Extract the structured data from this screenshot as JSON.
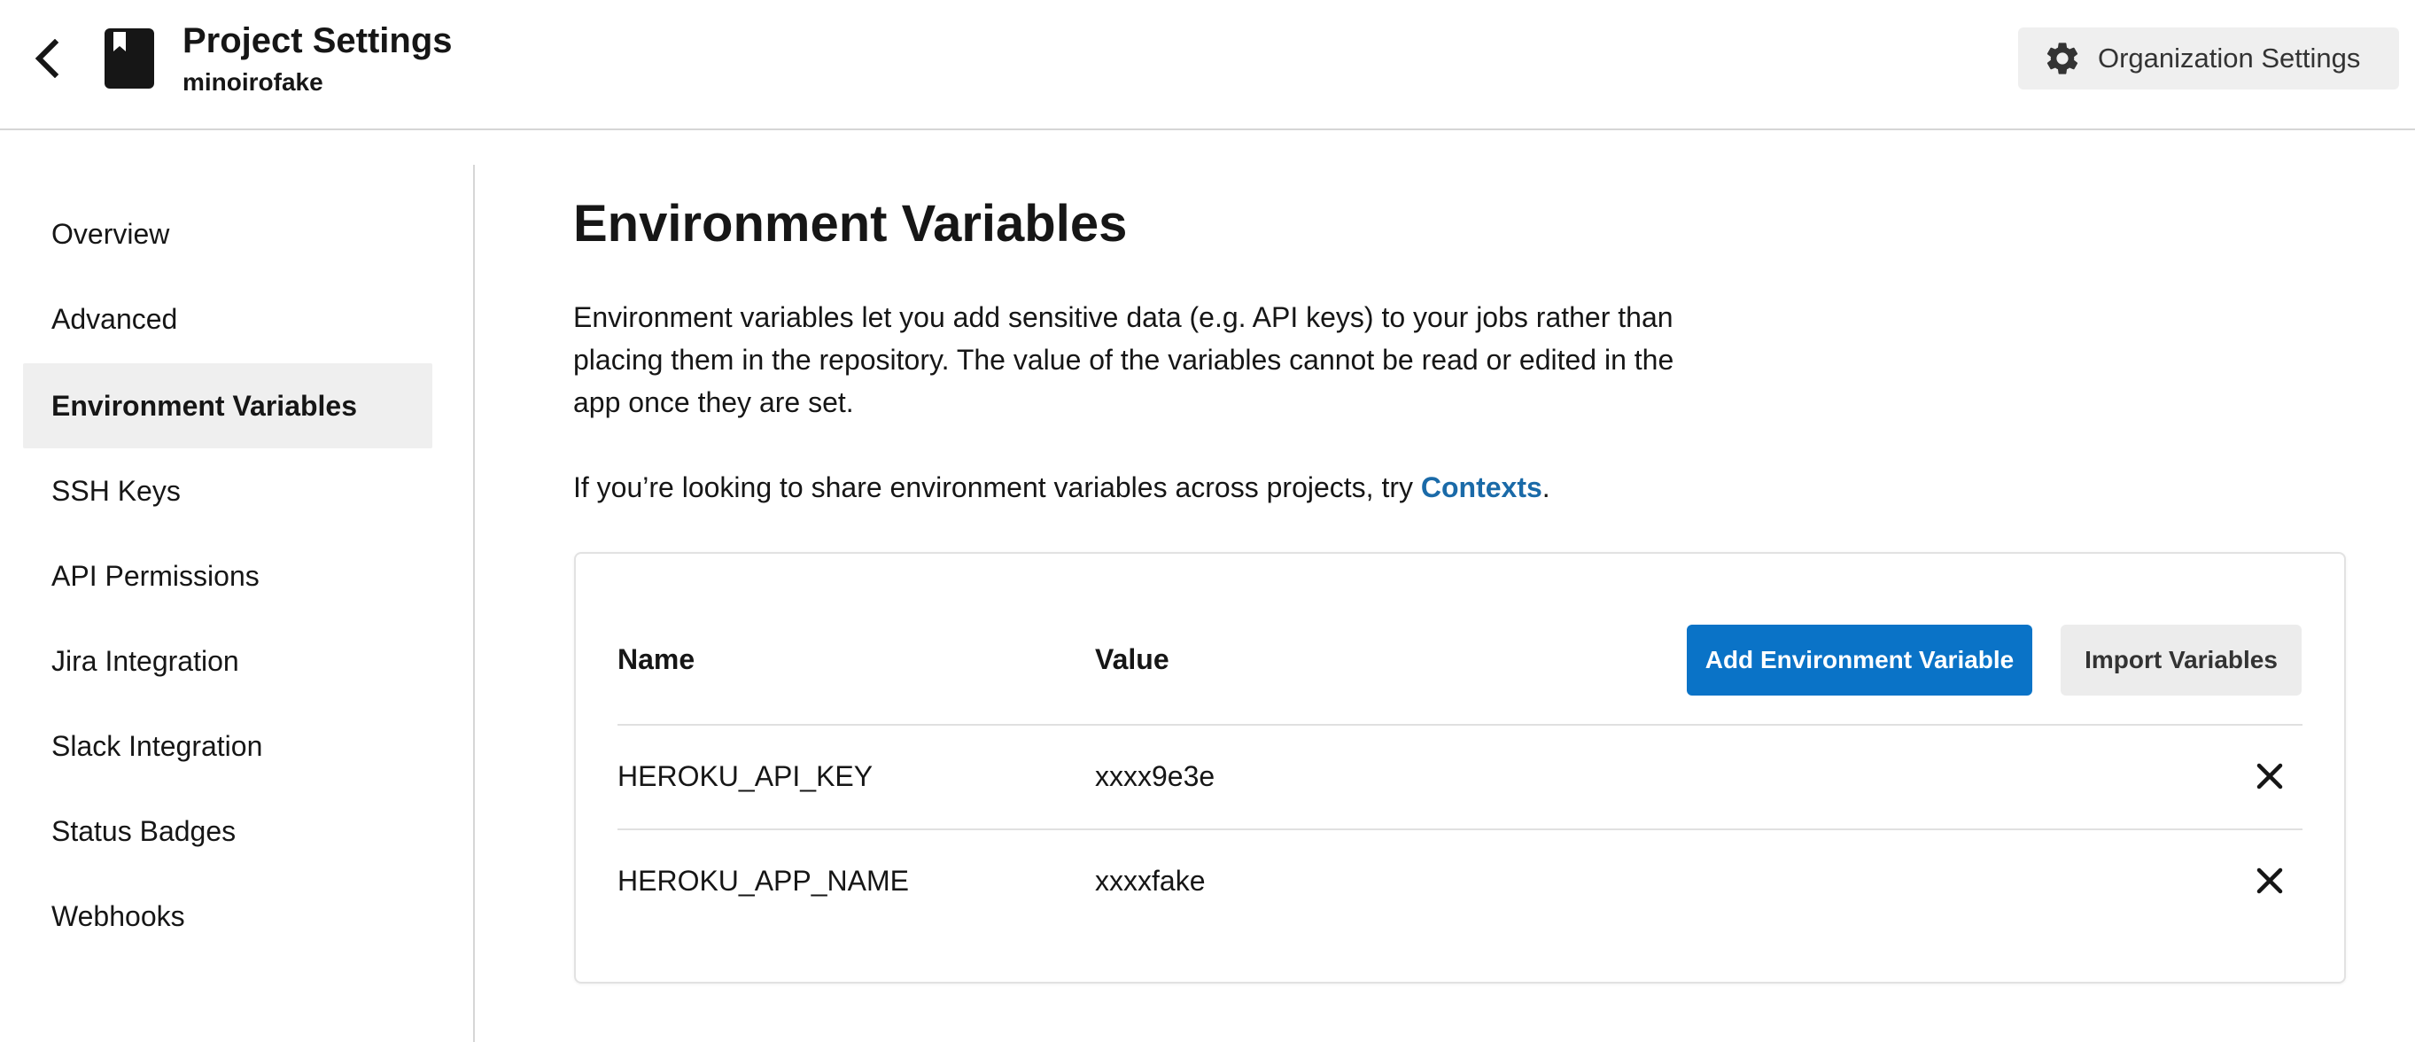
{
  "header": {
    "back_icon": "chevron-left-icon",
    "project_icon": "book-icon",
    "title": "Project Settings",
    "subtitle": "minoirofake",
    "org_settings_icon": "gear-icon",
    "org_settings_label": "Organization Settings"
  },
  "sidebar": {
    "items": [
      {
        "label": "Overview",
        "active": false
      },
      {
        "label": "Advanced",
        "active": false
      },
      {
        "label": "Environment Variables",
        "active": true
      },
      {
        "label": "SSH Keys",
        "active": false
      },
      {
        "label": "API Permissions",
        "active": false
      },
      {
        "label": "Jira Integration",
        "active": false
      },
      {
        "label": "Slack Integration",
        "active": false
      },
      {
        "label": "Status Badges",
        "active": false
      },
      {
        "label": "Webhooks",
        "active": false
      }
    ]
  },
  "main": {
    "title": "Environment Variables",
    "description": "Environment variables let you add sensitive data (e.g. API keys) to your jobs rather than placing them in the repository. The value of the variables cannot be read or edited in the app once they are set.",
    "share_prefix": "If you’re looking to share environment variables across projects, try ",
    "share_link": "Contexts",
    "share_suffix": "."
  },
  "table": {
    "col_name": "Name",
    "col_value": "Value",
    "add_button": "Add Environment Variable",
    "import_button": "Import Variables",
    "delete_icon": "close-icon",
    "rows": [
      {
        "name": "HEROKU_API_KEY",
        "value": "xxxx9e3e"
      },
      {
        "name": "HEROKU_APP_NAME",
        "value": "xxxxfake"
      }
    ]
  },
  "colors": {
    "primary_button": "#0a73c7",
    "link": "#1a6aa8",
    "active_nav_bg": "#efefef"
  }
}
